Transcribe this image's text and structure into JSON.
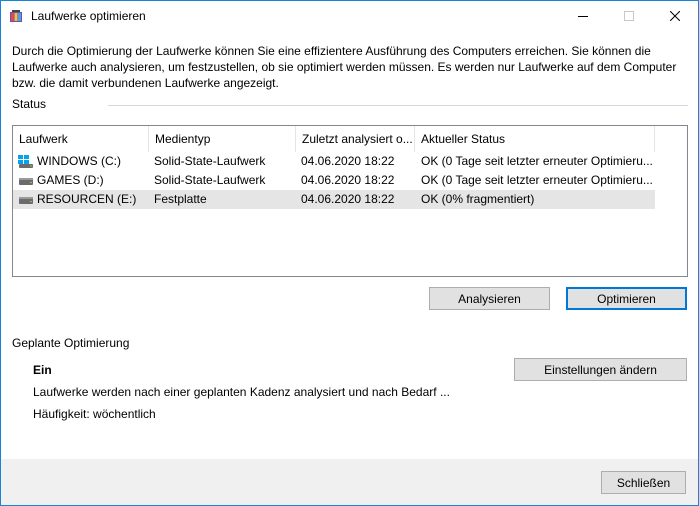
{
  "window": {
    "title": "Laufwerke optimieren",
    "minimize_glyph": "—",
    "maximize_glyph": "☐",
    "close_glyph": "✕"
  },
  "description": "Durch die Optimierung der Laufwerke können Sie eine effizientere Ausführung des Computers erreichen. Sie können die Laufwerke auch analysieren, um festzustellen, ob sie optimiert werden müssen. Es werden nur Laufwerke auf dem Computer bzw. die damit verbundenen Laufwerke angezeigt.",
  "status_section": {
    "label": "Status",
    "columns": [
      "Laufwerk",
      "Medientyp",
      "Zuletzt analysiert o...",
      "Aktueller Status"
    ],
    "drives": [
      {
        "name": "WINDOWS (C:)",
        "media": "Solid-State-Laufwerk",
        "last": "04.06.2020 18:22",
        "status": "OK (0 Tage seit letzter erneuter Optimieru...",
        "icon": "windows-drive-icon"
      },
      {
        "name": "GAMES (D:)",
        "media": "Solid-State-Laufwerk",
        "last": "04.06.2020 18:22",
        "status": "OK (0 Tage seit letzter erneuter Optimieru...",
        "icon": "hard-drive-icon"
      },
      {
        "name": "RESOURCEN (E:)",
        "media": "Festplatte",
        "last": "04.06.2020 18:22",
        "status": "OK (0% fragmentiert)",
        "icon": "hard-drive-icon"
      }
    ],
    "selected_index": 2,
    "analyze_label": "Analysieren",
    "optimize_label": "Optimieren"
  },
  "schedule": {
    "label": "Geplante Optimierung",
    "state": "Ein",
    "detail": "Laufwerke werden nach einer geplanten Kadenz analysiert und nach Bedarf ...",
    "frequency": "Häufigkeit: wöchentlich",
    "change_label": "Einstellungen ändern"
  },
  "footer": {
    "close_label": "Schließen"
  },
  "colors": {
    "accent": "#0078d7",
    "selected_row": "#e5e5e5",
    "button_face": "#e1e1e1",
    "footer_bg": "#f0f0f0"
  }
}
